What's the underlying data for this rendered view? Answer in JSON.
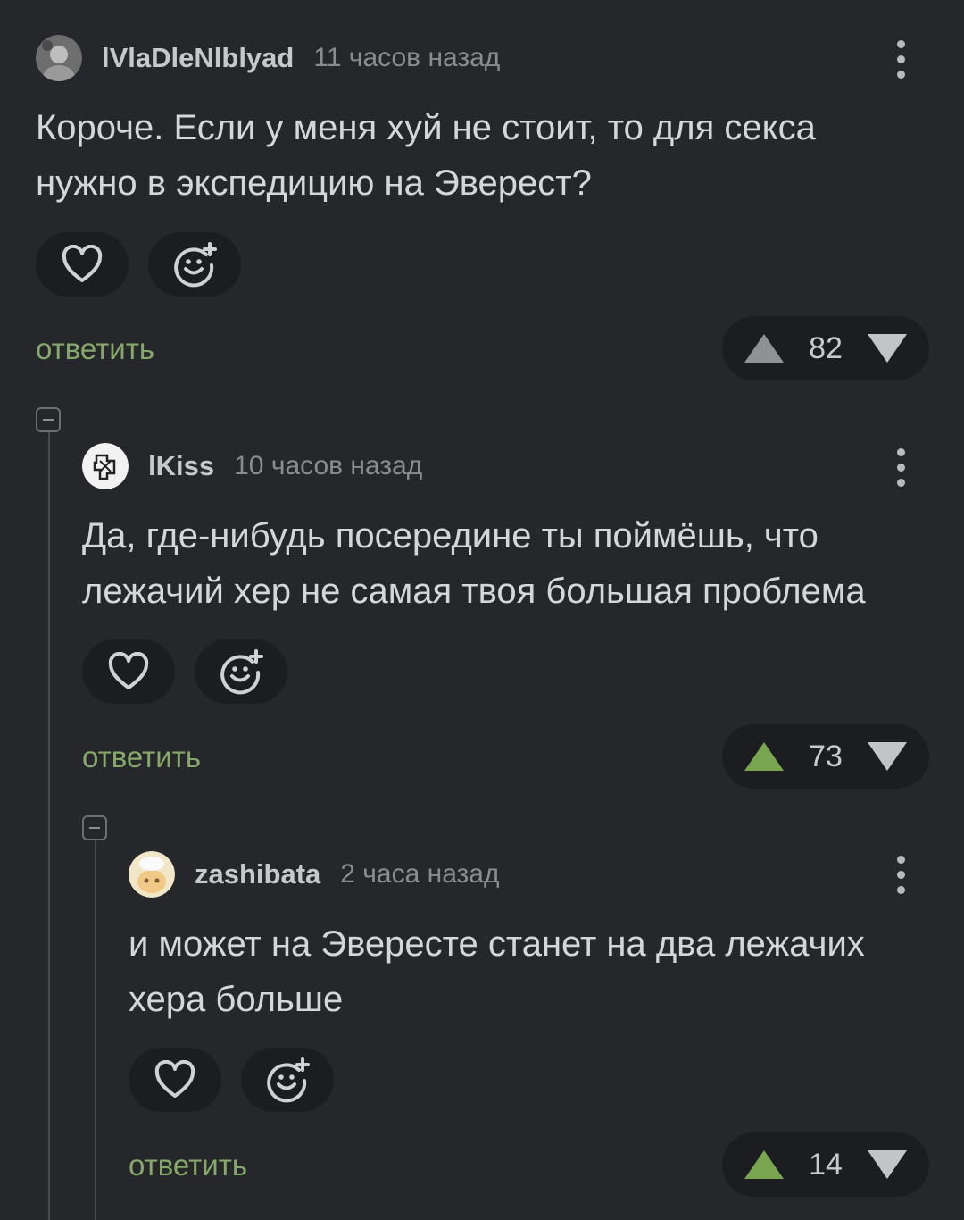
{
  "comments": [
    {
      "username": "lVlaDleNlblyad",
      "time": "11 часов назад",
      "text_lines": [
        "Короче. Если у меня хуй не стоит, то для секса",
        "нужно в экспедицию на Эверест?"
      ],
      "reply_label": "ответить",
      "votes": "82",
      "upvoted": false
    },
    {
      "username": "lKiss",
      "time": "10 часов назад",
      "text_lines": [
        "Да, где-нибудь посередине ты поймёшь, что",
        "лежачий хер не самая твоя большая проблема"
      ],
      "reply_label": "ответить",
      "votes": "73",
      "upvoted": true
    },
    {
      "username": "zashibata",
      "time": "2 часа назад",
      "text_lines": [
        "и может на Эвересте станет на два лежачих",
        "хера больше"
      ],
      "reply_label": "ответить",
      "votes": "14",
      "upvoted": true
    }
  ],
  "icons": {
    "like": "heart-icon",
    "react": "smiley-plus-icon",
    "more": "more-vertical-icon",
    "upvote": "triangle-up-icon",
    "downvote": "triangle-down-icon",
    "collapse": "collapse-minus-icon"
  },
  "colors": {
    "background": "#25272b",
    "reply": "#87a86b",
    "upvote_active": "#79a450",
    "upvote_inactive": "#8f9195"
  }
}
